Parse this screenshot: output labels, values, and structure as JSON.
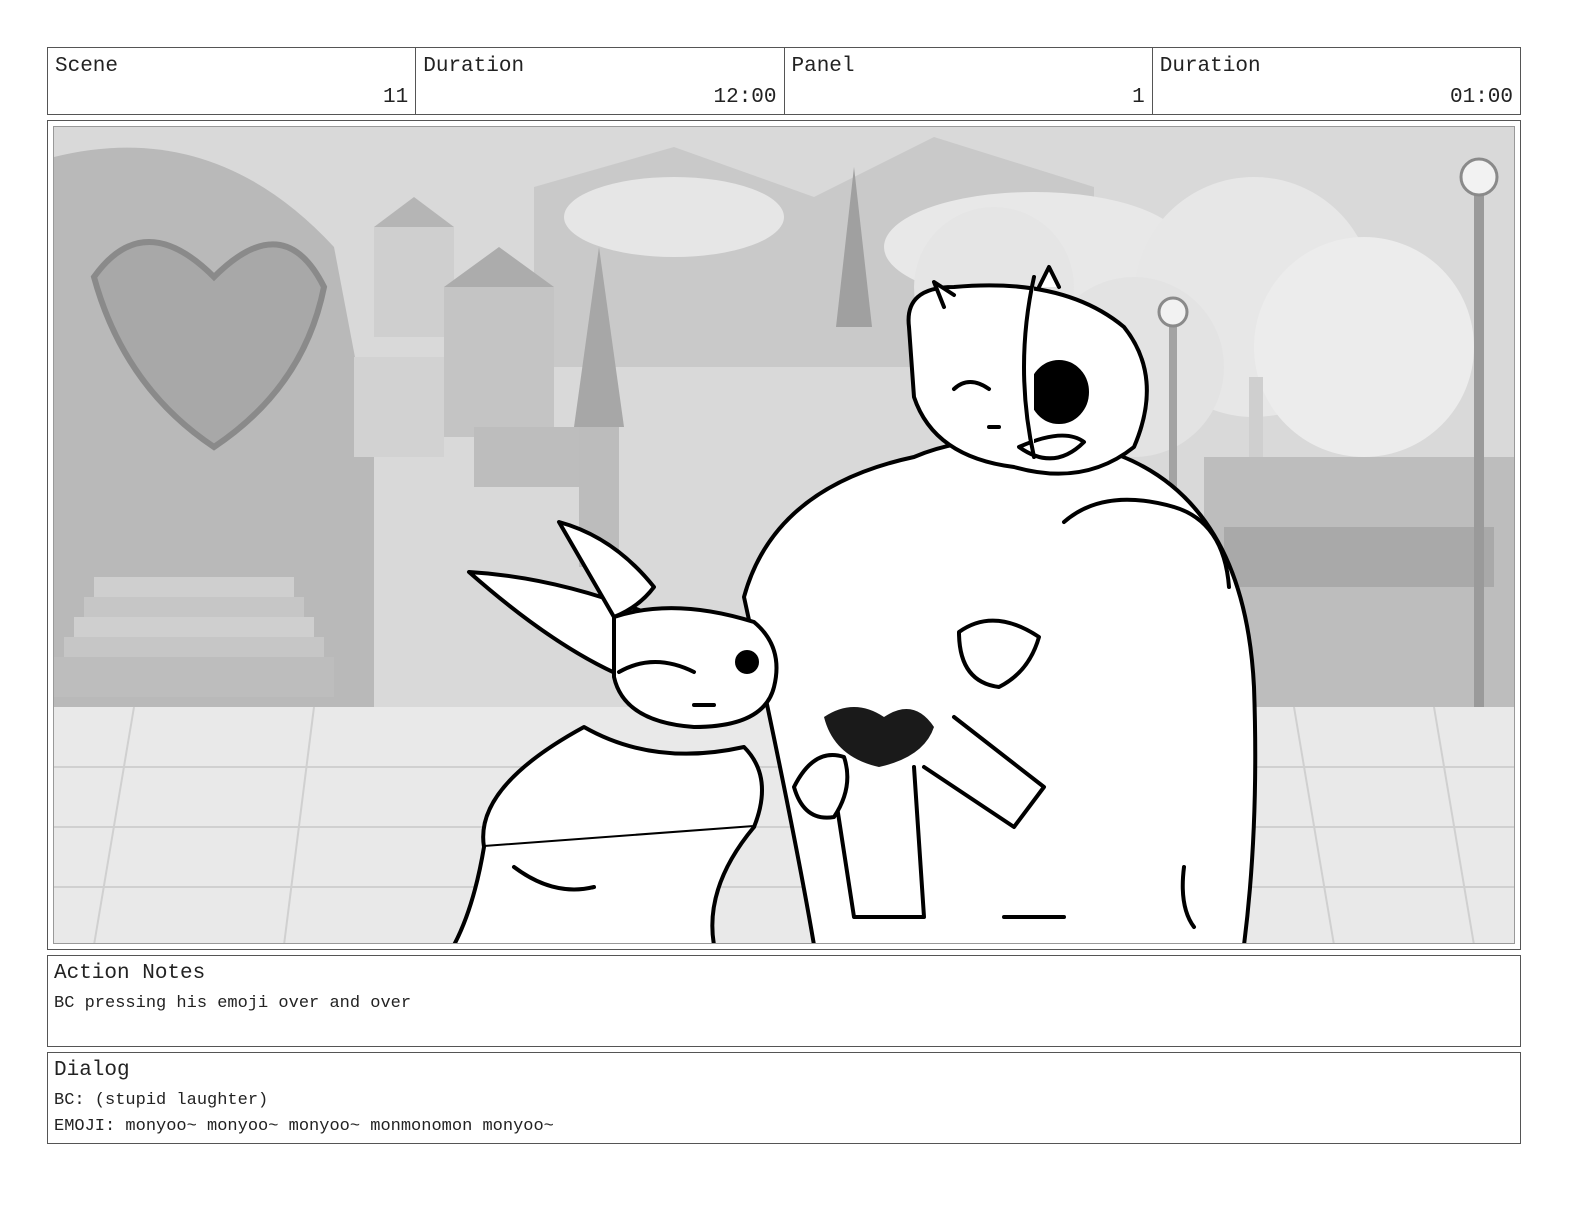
{
  "header": {
    "scene_label": "Scene",
    "scene_value": "11",
    "scene_duration_label": "Duration",
    "scene_duration_value": "12:00",
    "panel_label": "Panel",
    "panel_value": "1",
    "panel_duration_label": "Duration",
    "panel_duration_value": "01:00"
  },
  "panel": {
    "image_name": "storyboard-panel-drawing"
  },
  "action_notes": {
    "title": "Action Notes",
    "text": "BC pressing his emoji over and over"
  },
  "dialog": {
    "title": "Dialog",
    "lines": [
      "BC: (stupid laughter)",
      "EMOJI: monyoo~ monyoo~ monyoo~ monmonomon monyoo~"
    ]
  }
}
